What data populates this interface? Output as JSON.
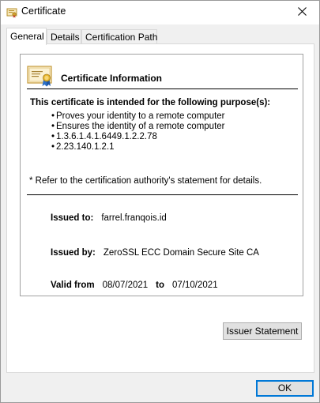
{
  "window": {
    "title": "Certificate",
    "close_label": "✕"
  },
  "tabs": [
    {
      "label": "General",
      "active": true
    },
    {
      "label": "Details",
      "active": false
    },
    {
      "label": "Certification Path",
      "active": false
    }
  ],
  "info": {
    "title": "Certificate Information",
    "purpose_heading": "This certificate is intended for the following purpose(s):",
    "purposes": [
      "Proves your identity to a remote computer",
      "Ensures the identity of a remote computer",
      "1.3.6.1.4.1.6449.1.2.2.78",
      "2.23.140.1.2.1"
    ],
    "note": "* Refer to the certification authority's statement for details.",
    "issued_to_label": "Issued to:",
    "issued_to": "farrel.franqois.id",
    "issued_by_label": "Issued by:",
    "issued_by": "ZeroSSL ECC Domain Secure Site CA",
    "valid_from_label": "Valid from",
    "valid_from": "08/07/2021",
    "valid_to_label": "to",
    "valid_to": "07/10/2021"
  },
  "buttons": {
    "issuer_statement": "Issuer Statement",
    "ok": "OK"
  },
  "icons": {
    "window_icon": "certificate-icon",
    "info_icon": "certificate-ribbon-icon",
    "close": "close-icon"
  },
  "colors": {
    "focus_border": "#0078d7",
    "button_face": "#e1e1e1"
  }
}
